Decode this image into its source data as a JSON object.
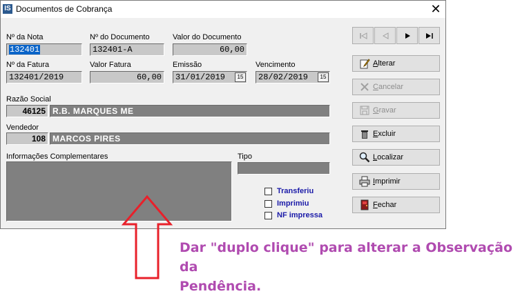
{
  "window": {
    "title": "Documentos de Cobrança",
    "app_icon": "IS"
  },
  "fields": {
    "nota": {
      "label": "Nº da Nota",
      "value": "132401"
    },
    "documento": {
      "label": "Nº do Documento",
      "value": "132401-A"
    },
    "valor_documento": {
      "label": "Valor do Documento",
      "value": "60,00"
    },
    "fatura": {
      "label": "Nº da Fatura",
      "value": "132401/2019"
    },
    "valor_fatura": {
      "label": "Valor Fatura",
      "value": "60,00"
    },
    "emissao": {
      "label": "Emissão",
      "value": "31/01/2019"
    },
    "vencimento": {
      "label": "Vencimento",
      "value": "28/02/2019"
    },
    "razao_social": {
      "label": "Razão Social",
      "code": "46125",
      "value": "R.B. MARQUES ME"
    },
    "vendedor": {
      "label": "Vendedor",
      "code": "108",
      "value": "MARCOS PIRES"
    },
    "info": {
      "label": "Informações Complementares"
    },
    "tipo": {
      "label": "Tipo",
      "value": ""
    }
  },
  "calendar_glyph": "15",
  "checkboxes": [
    {
      "label": "Transferiu",
      "checked": false
    },
    {
      "label": "Imprimiu",
      "checked": false
    },
    {
      "label": "NF impressa",
      "checked": false
    }
  ],
  "buttons": {
    "alterar": {
      "key": "A",
      "rest": "lterar"
    },
    "cancelar": {
      "key": "C",
      "rest": "ancelar"
    },
    "gravar": {
      "key": "G",
      "rest": "ravar"
    },
    "excluir": {
      "key": "E",
      "rest": "xcluir"
    },
    "localizar": {
      "key": "L",
      "rest": "ocalizar"
    },
    "imprimir": {
      "key": "I",
      "rest": "mprimir"
    },
    "fechar": {
      "key": "F",
      "rest": "echar"
    }
  },
  "annotation": {
    "line1": "Dar \"duplo clique\" para alterar a Observação da",
    "line2": "Pendência."
  },
  "colors": {
    "annotation": "#b04bb0",
    "arrow": "#e8202a",
    "checkbox_text": "#1a1aa8"
  }
}
